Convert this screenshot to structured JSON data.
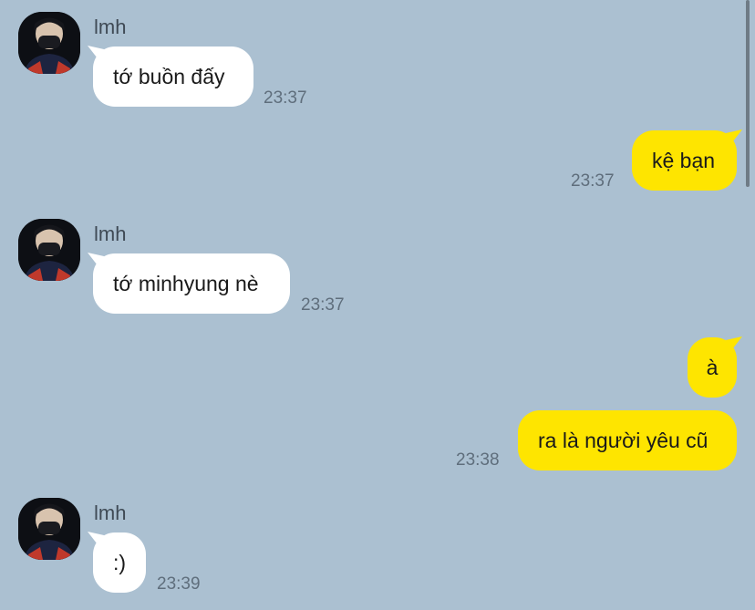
{
  "colors": {
    "background": "#abc0d1",
    "incoming_bubble": "#ffffff",
    "outgoing_bubble": "#fee500"
  },
  "messages": [
    {
      "direction": "in",
      "sender": "lmh",
      "text": "tớ buồn đấy",
      "time": "23:37"
    },
    {
      "direction": "out",
      "text": "kệ bạn",
      "time": "23:37"
    },
    {
      "direction": "in",
      "sender": "lmh",
      "text": "tớ minhyung nè",
      "time": "23:37"
    },
    {
      "direction": "out",
      "text": "à",
      "time": ""
    },
    {
      "direction": "out",
      "text": "ra là người yêu cũ",
      "time": "23:38"
    },
    {
      "direction": "in",
      "sender": "lmh",
      "text": ":)",
      "time": "23:39"
    }
  ]
}
